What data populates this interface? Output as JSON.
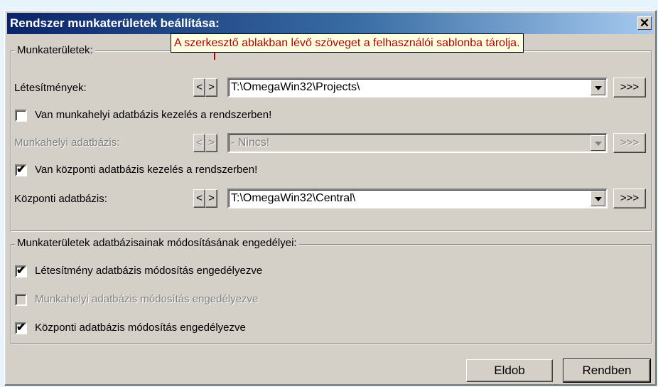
{
  "dialog": {
    "title": "Rendszer munkaterületek beállítása:",
    "close_glyph": "✕"
  },
  "tooltip": {
    "text": "A szerkesztő ablakban lévő szöveget a felhasználói sablonba tárolja."
  },
  "workspaces": {
    "group_label": "Munkaterületek:",
    "facilities": {
      "label": "Létesítmények:",
      "path": "T:\\OmegaWin32\\Projects\\",
      "prev": "<",
      "next": ">",
      "browse": ">>>"
    },
    "local_db_checkbox": {
      "label": "Van munkahelyi adatbázis kezelés a rendszerben!",
      "checked": false
    },
    "local_db": {
      "label": "Munkahelyi adatbázis:",
      "path": "- Nincs!",
      "prev": "<",
      "next": ">",
      "browse": ">>>"
    },
    "central_db_checkbox": {
      "label": "Van központi adatbázis kezelés a rendszerben!",
      "checked": true
    },
    "central_db": {
      "label": "Központi adatbázis:",
      "path": "T:\\OmegaWin32\\Central\\",
      "prev": "<",
      "next": ">",
      "browse": ">>>"
    }
  },
  "permissions": {
    "group_label": "Munkaterületek adatbázisainak módosításának engedélyei:",
    "facility_edit": {
      "label": "Létesítmény adatbázis módosítás engedélyezve",
      "checked": true
    },
    "local_edit": {
      "label": "Munkahelyi adatbázis módosítás engedélyezve",
      "checked": false
    },
    "central_edit": {
      "label": "Központi adatbázis módosítás engedélyezve",
      "checked": true
    }
  },
  "buttons": {
    "discard": "Eldob",
    "ok": "Rendben"
  },
  "check_glyph": "✔"
}
